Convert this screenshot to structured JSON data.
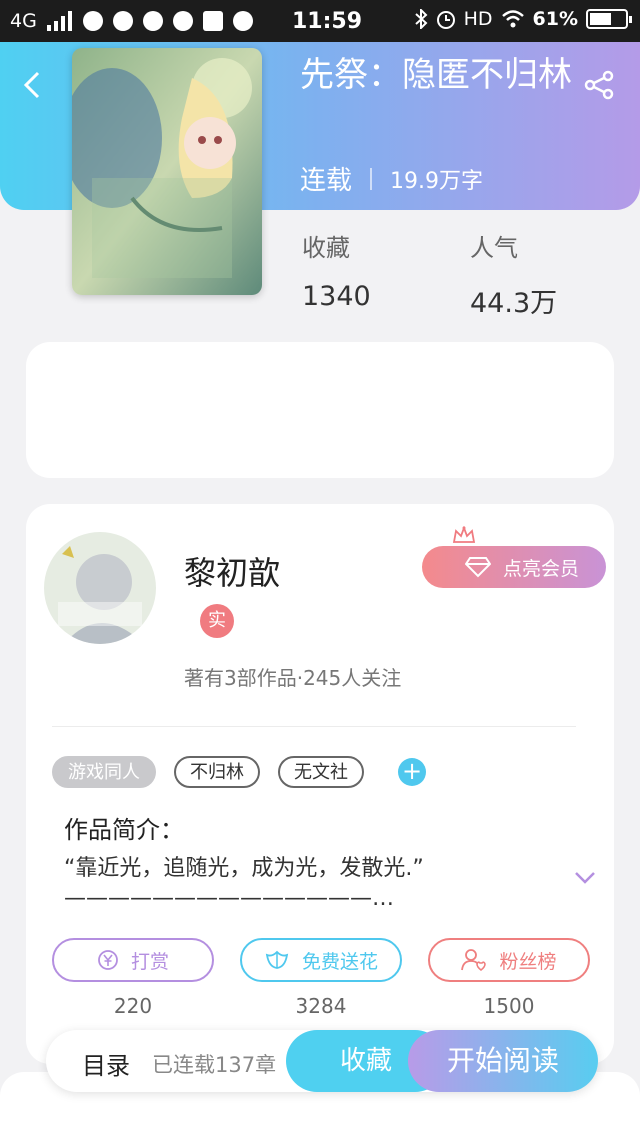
{
  "status_bar": {
    "network": "4G",
    "time": "11:59",
    "hd": "HD",
    "battery": "61%",
    "battery_level": 0.61
  },
  "book": {
    "title": "先祭：隐匿不归林",
    "status": "连载",
    "word_count": "19.9万字",
    "favorites_label": "收藏",
    "favorites_value": "1340",
    "popularity_label": "人气",
    "popularity_value": "44.3万",
    "cover_icon": "book-cover-illustration"
  },
  "author": {
    "name": "黎初歆",
    "verified_badge": "实",
    "vip_label": "点亮会员",
    "stats": "著有3部作品·245人关注",
    "avatar_icon": "author-avatar"
  },
  "tags": [
    "游戏同人",
    "不归林",
    "无文社"
  ],
  "intro": {
    "title": "作品简介：",
    "text": "“靠近光，追随光，成为光，发散光.”\n——————————————…"
  },
  "actions": [
    {
      "label": "打赏",
      "count": "220",
      "color": "#b48fe0",
      "icon": "yen-icon"
    },
    {
      "label": "免费送花",
      "count": "3284",
      "color": "#4fc8ee",
      "icon": "flower-icon"
    },
    {
      "label": "粉丝榜",
      "count": "1500",
      "color": "#ef7f7f",
      "icon": "fans-icon"
    }
  ],
  "bottom_bar": {
    "toc_label": "目录",
    "chapter_status": "已连载137章",
    "collect_label": "收藏",
    "read_label": "开始阅读"
  }
}
